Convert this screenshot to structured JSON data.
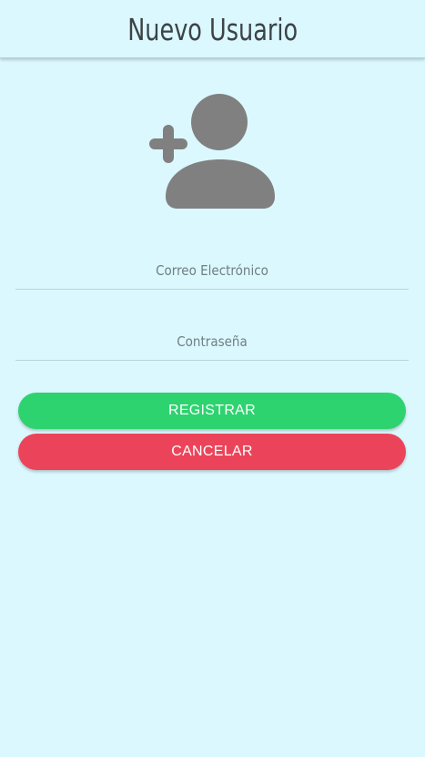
{
  "header": {
    "title": "Nuevo Usuario"
  },
  "avatar": {
    "icon": "person-add-icon",
    "color": "#808080"
  },
  "form": {
    "email_placeholder": "Correo Electrónico",
    "email_value": "",
    "password_placeholder": "Contraseña",
    "password_value": ""
  },
  "buttons": {
    "register_label": "REGISTRAR",
    "cancel_label": "CANCELAR"
  },
  "colors": {
    "background": "#dbf8fe",
    "success": "#2dd36f",
    "danger": "#eb445a"
  }
}
